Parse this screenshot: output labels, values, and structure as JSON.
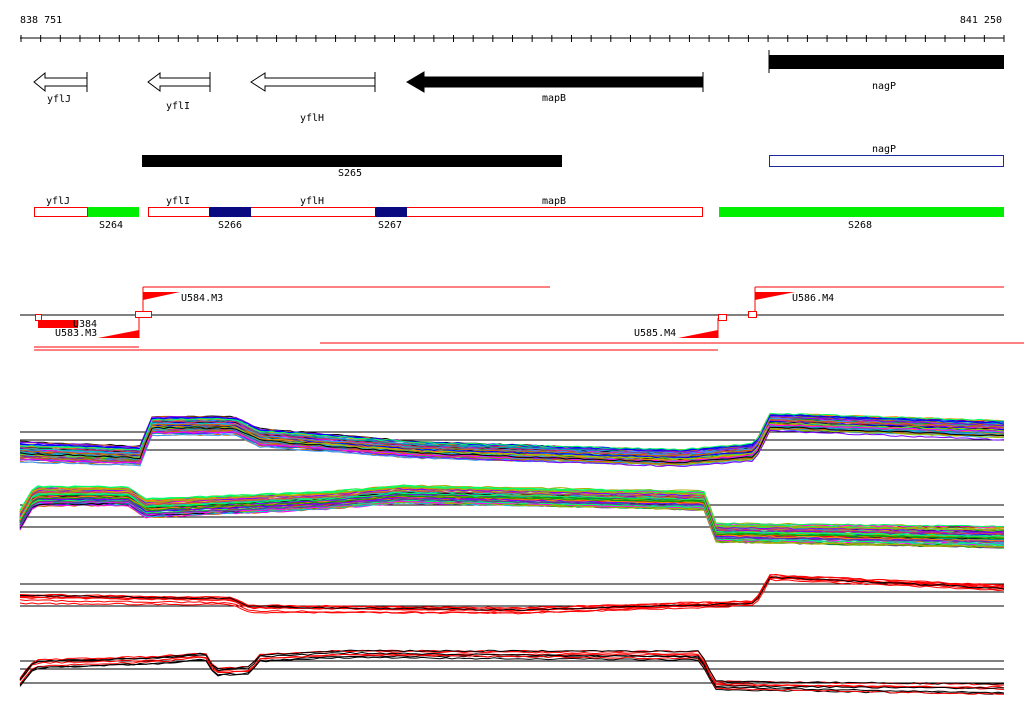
{
  "coordinates": {
    "start": "838 751",
    "end": "841 250"
  },
  "genes": [
    {
      "label": "yflJ",
      "strand": "-",
      "filled": false
    },
    {
      "label": "yflI",
      "strand": "-",
      "filled": false
    },
    {
      "label": "yflH",
      "strand": "-",
      "filled": false
    },
    {
      "label": "mapB",
      "strand": "-",
      "filled": true
    },
    {
      "label": "nagP",
      "strand": "+",
      "filled": true
    }
  ],
  "segments_row": [
    {
      "label": "S265",
      "color": "#000000"
    },
    {
      "label": "nagP",
      "color": "#1e2b9e"
    }
  ],
  "annotation_row": {
    "gene_labels": [
      "yflJ",
      "yflI",
      "yflH",
      "mapB"
    ],
    "blocks": [
      {
        "label": "S264",
        "color": "#00ee00"
      },
      {
        "label": "S266",
        "color": "#0a0a80"
      },
      {
        "label": "S267",
        "color": "#0a0a80"
      },
      {
        "label": "S268",
        "color": "#00ee00"
      }
    ]
  },
  "transcripts": [
    {
      "label": "U584.M3"
    },
    {
      "label": "U586.M4"
    },
    {
      "label": "U583.M3"
    },
    {
      "label": "U585.M4"
    },
    {
      "label": "U384"
    }
  ],
  "colors": {
    "accent_red": "#ff0000",
    "gene_fill": "#000000",
    "track_line": "#000000"
  }
}
